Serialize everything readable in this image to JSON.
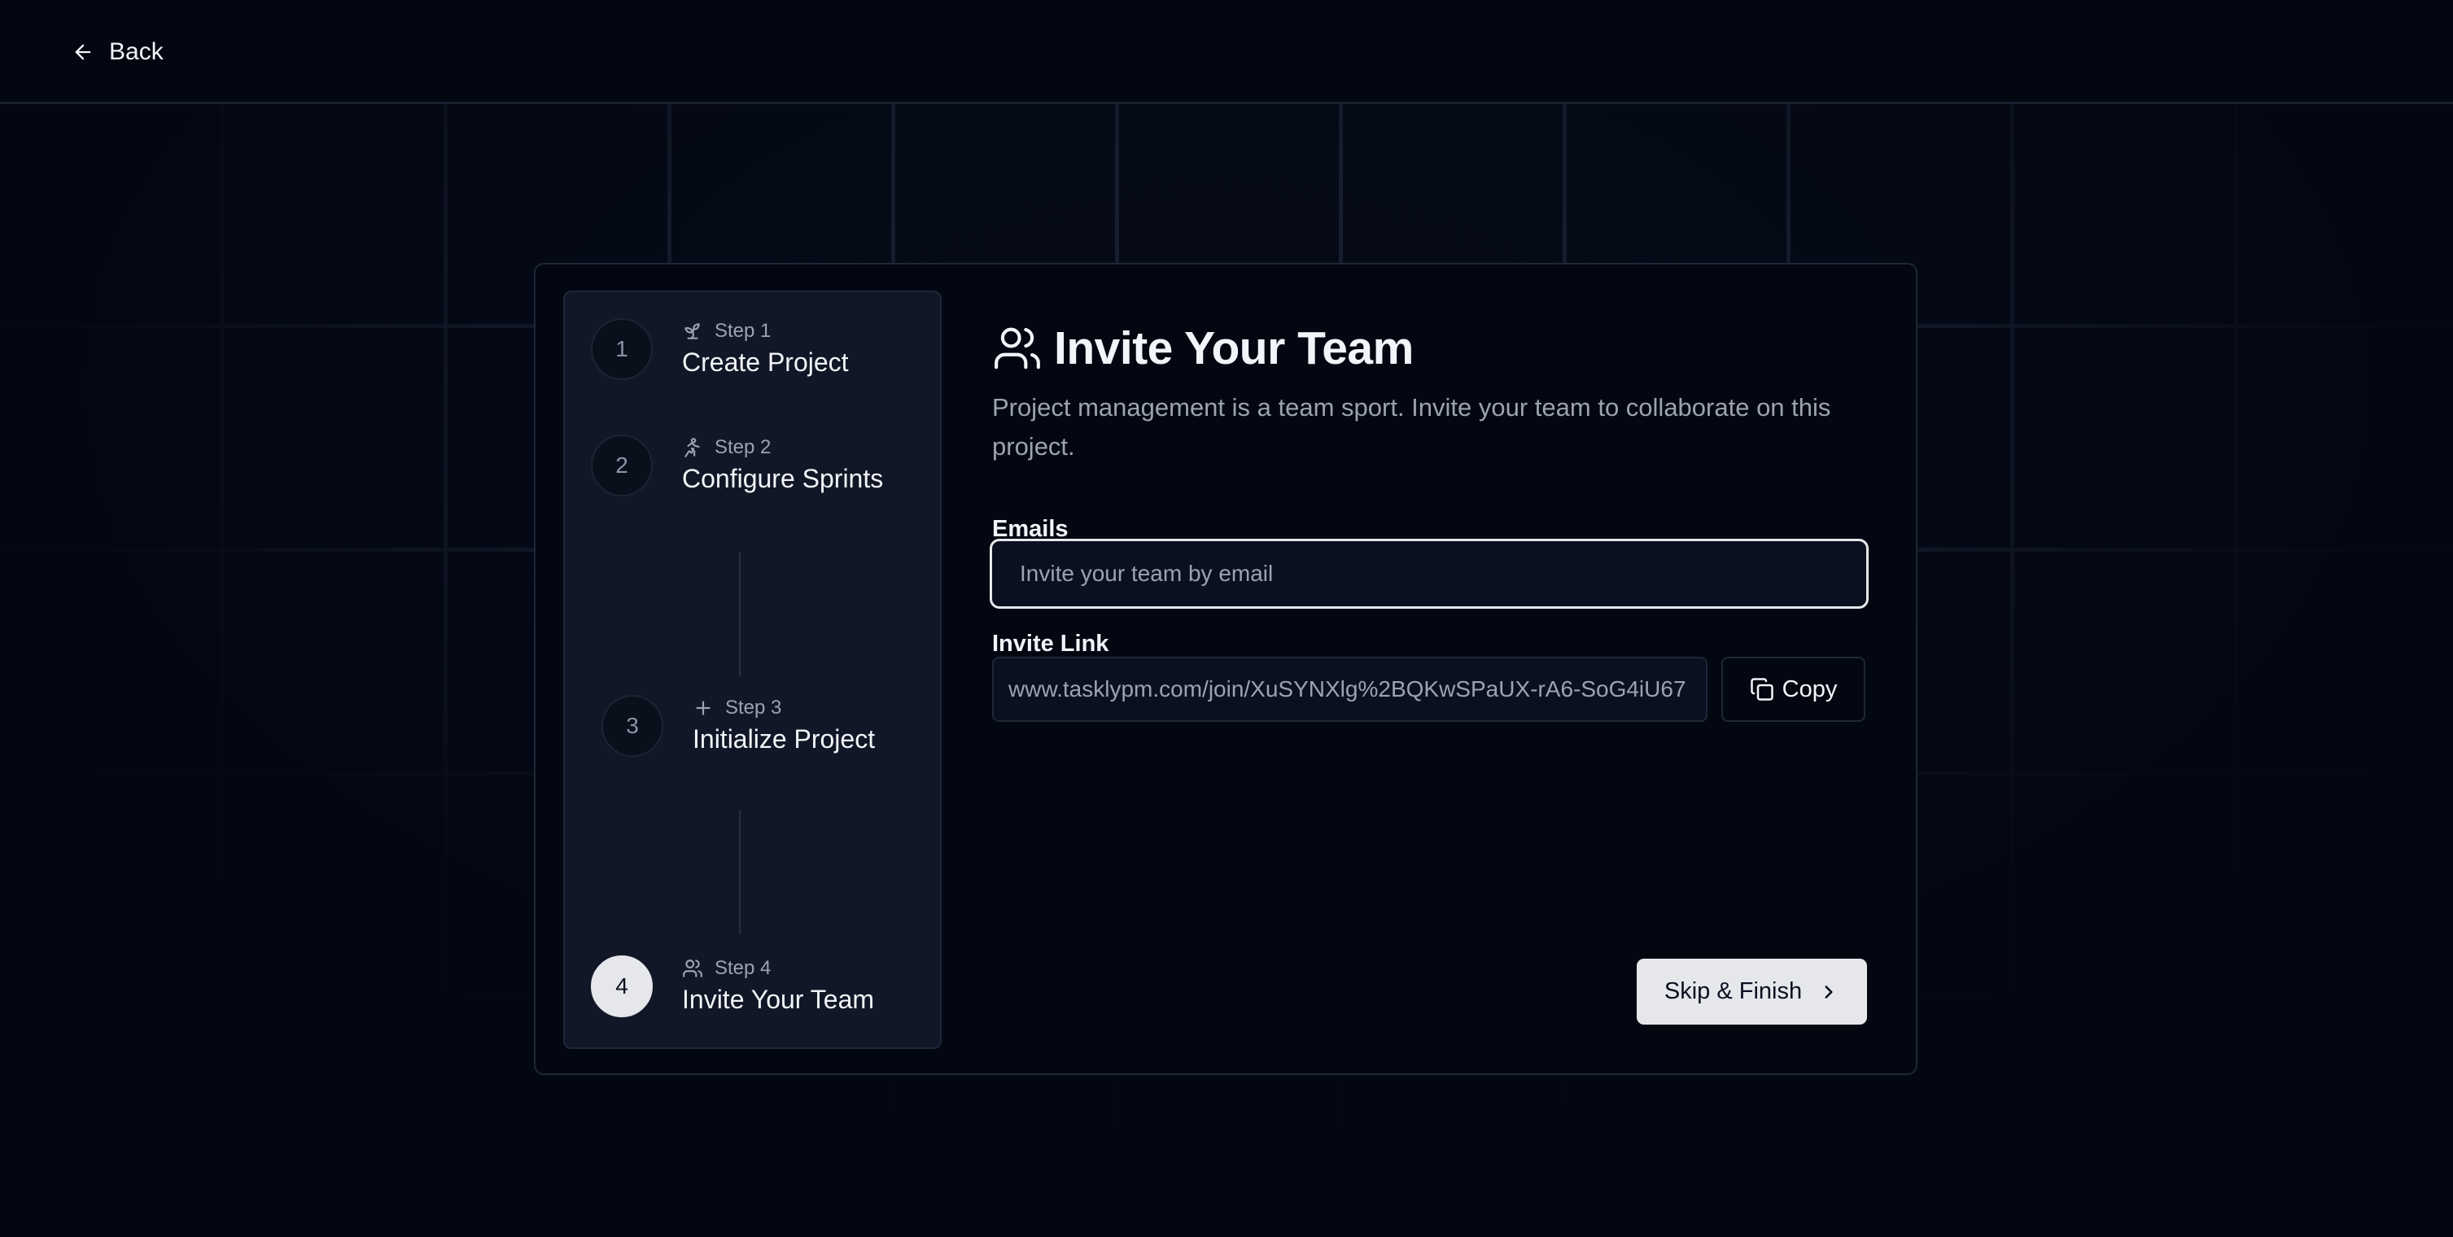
{
  "header": {
    "back_label": "Back"
  },
  "steps": [
    {
      "number": "1",
      "step_label": "Step 1",
      "title": "Create Project",
      "icon": "sprout-icon",
      "active": false
    },
    {
      "number": "2",
      "step_label": "Step 2",
      "title": "Configure Sprints",
      "icon": "running-person-icon",
      "active": false
    },
    {
      "number": "3",
      "step_label": "Step 3",
      "title": "Initialize Project",
      "icon": "plus-icon",
      "active": false
    },
    {
      "number": "4",
      "step_label": "Step 4",
      "title": "Invite Your Team",
      "icon": "users-icon",
      "active": true
    }
  ],
  "main": {
    "title": "Invite Your Team",
    "title_icon": "users-icon",
    "description": "Project management is a team sport. Invite your team to collaborate on this project.",
    "emails_label": "Emails",
    "emails_placeholder": "Invite your team by email",
    "emails_value": "",
    "invite_link_label": "Invite Link",
    "invite_link_value": "www.tasklypm.com/join/XuSYNXlg%2BQKwSPaUX-rA6-SoG4iU67",
    "copy_label": "Copy",
    "finish_label": "Skip & Finish"
  },
  "colors": {
    "background": "#030712",
    "card_border": "#1f2636",
    "sidebar": "#111726",
    "accent_light": "#e5e7eb",
    "muted_text": "#9ca3af"
  }
}
